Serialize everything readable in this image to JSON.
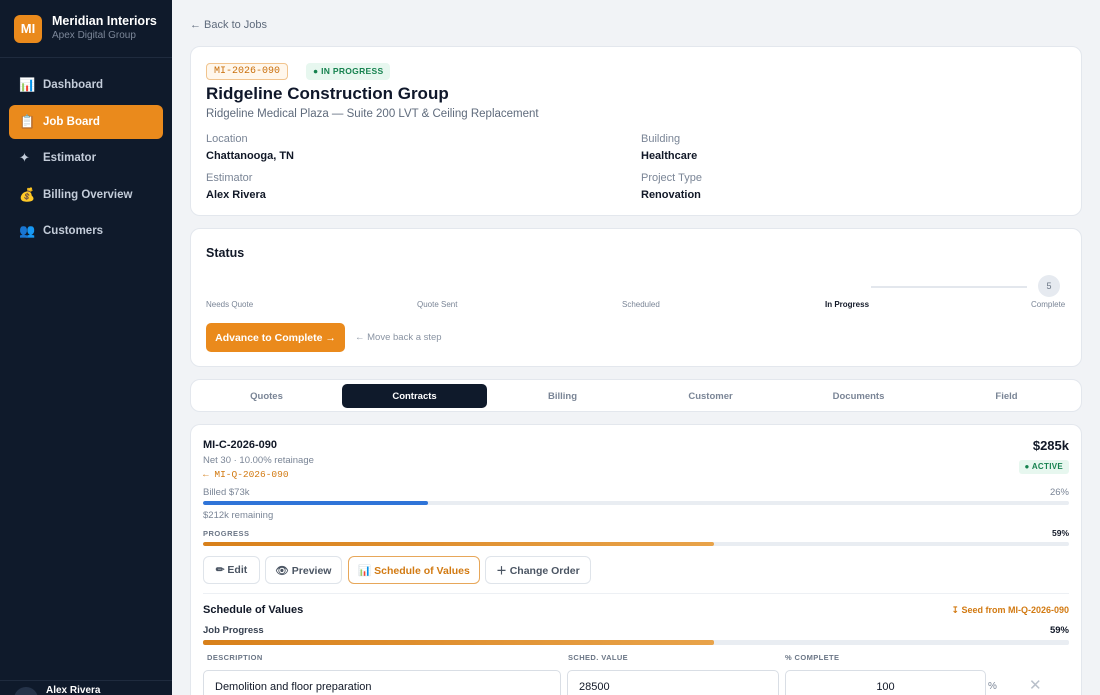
{
  "brand": {
    "logo": "MI",
    "name": "Meridian Interiors",
    "sub": "Apex Digital Group"
  },
  "nav": [
    {
      "icon": "📊",
      "label": "Dashboard"
    },
    {
      "icon": "📋",
      "label": "Job Board"
    },
    {
      "icon": "✦",
      "label": "Estimator"
    },
    {
      "icon": "💰",
      "label": "Billing Overview"
    },
    {
      "icon": "👥",
      "label": "Customers"
    }
  ],
  "user": {
    "name": "Alex Rivera"
  },
  "back_link": "← Back to Jobs",
  "job": {
    "id": "MI-2026-090",
    "status": "● IN PROGRESS",
    "title": "Ridgeline Construction Group",
    "subtitle": "Ridgeline Medical Plaza — Suite 200 LVT & Ceiling Replacement",
    "location_label": "Location",
    "location": "Chattanooga, TN",
    "building_label": "Building",
    "building": "Healthcare",
    "estimator_label": "Estimator",
    "estimator": "Alex Rivera",
    "type_label": "Project Type",
    "type": "Renovation"
  },
  "status_section": {
    "title": "Status",
    "steps": [
      "Needs Quote",
      "Quote Sent",
      "Scheduled",
      "In Progress",
      "Complete"
    ],
    "final_step_number": "5",
    "advance_label": "Advance to Complete →",
    "back_label": "← Move back a step"
  },
  "tabs": [
    "Quotes",
    "Contracts",
    "Billing",
    "Customer",
    "Documents",
    "Field"
  ],
  "contract": {
    "id": "MI-C-2026-090",
    "terms": "Net 30 · 10.00% retainage",
    "quote_ref": "← MI-Q-2026-090",
    "amount": "$285k",
    "status": "● ACTIVE",
    "billed_label": "Billed $73k",
    "billed_pct": "26%",
    "billed_fraction": 0.26,
    "remaining": "$212k remaining",
    "progress_label": "PROGRESS",
    "progress_pct": "59%",
    "progress_fraction": 0.59,
    "buttons": {
      "edit": "✏ Edit",
      "preview": "👁 Preview",
      "sov": "📊 Schedule of Values",
      "change_order": "＋ Change Order"
    }
  },
  "sov": {
    "title": "Schedule of Values",
    "seed": "↧ Seed from MI-Q-2026-090",
    "job_progress_label": "Job Progress",
    "job_progress_pct": "59%",
    "job_progress_fraction": 0.59,
    "columns": [
      "DESCRIPTION",
      "SCHED. VALUE",
      "% COMPLETE"
    ],
    "rows": [
      {
        "description": "Demolition and floor preparation",
        "value": "28500",
        "pct": "100"
      }
    ],
    "pct_symbol": "%"
  },
  "colors": {
    "accent": "#ea8a1c",
    "sidebar": "#0f1a2b",
    "blue": "#2f74d8",
    "success": "#16824f"
  }
}
